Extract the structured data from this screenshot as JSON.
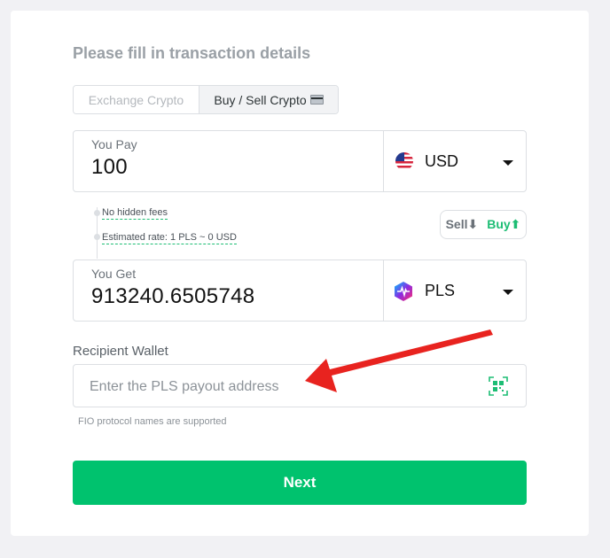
{
  "form": {
    "title": "Please fill in transaction details",
    "tabs": [
      {
        "label": "Exchange Crypto",
        "active": false
      },
      {
        "label": "Buy / Sell Crypto",
        "active": true
      }
    ]
  },
  "you_pay": {
    "label": "You Pay",
    "value": "100",
    "currency": "USD",
    "currency_icon": "us-flag-icon"
  },
  "rates": {
    "no_fees": "No hidden fees",
    "estimated_rate": "Estimated rate: 1 PLS ~ 0 USD"
  },
  "toggle": {
    "sell_label": "Sell",
    "buy_label": "Buy",
    "active": "Buy"
  },
  "you_get": {
    "label": "You Get",
    "value": "913240.6505748",
    "currency": "PLS",
    "currency_icon": "pulsechain-icon"
  },
  "recipient": {
    "label": "Recipient Wallet",
    "placeholder": "Enter the PLS payout address",
    "value": "",
    "note": "FIO protocol names are supported"
  },
  "actions": {
    "next_label": "Next"
  },
  "colors": {
    "accent": "#00c26e",
    "annotation_arrow": "#e8231f"
  }
}
